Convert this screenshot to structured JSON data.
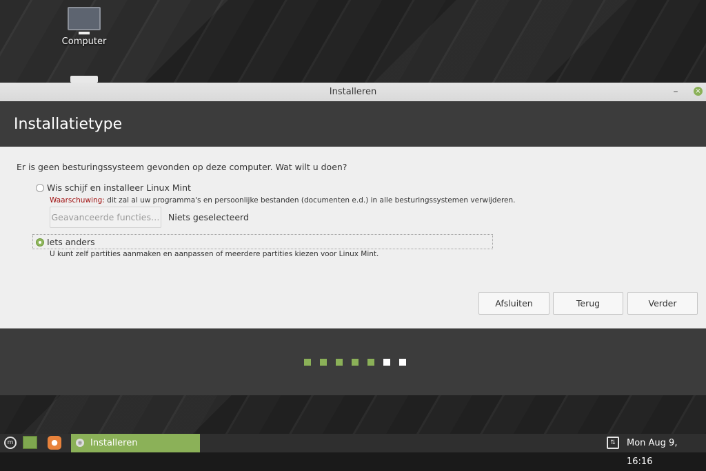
{
  "desktop": {
    "icons": [
      {
        "label": "Computer",
        "icon": "computer-icon"
      }
    ]
  },
  "window": {
    "title": "Installeren",
    "minimize_glyph": "–",
    "close_glyph": "×"
  },
  "header": {
    "title": "Installatietype"
  },
  "content": {
    "question": "Er is geen besturingssysteem gevonden op deze computer. Wat wilt u doen?",
    "option_erase": {
      "label": "Wis schijf en installeer Linux Mint",
      "selected": false,
      "warning_label": "Waarschuwing:",
      "warning_text": " dit zal al uw programma's en persoonlijke bestanden (documenten e.d.) in alle besturingssystemen verwijderen.",
      "advanced_button": "Geavanceerde functies…",
      "advanced_status": "Niets geselecteerd"
    },
    "option_other": {
      "label": "Iets anders",
      "selected": true,
      "description": "U kunt zelf partities aanmaken en aanpassen of meerdere partities kiezen voor Linux Mint."
    }
  },
  "buttons": {
    "quit": "Afsluiten",
    "back": "Terug",
    "next": "Verder"
  },
  "progress": {
    "total_steps": 7,
    "completed_steps": 5,
    "colors": {
      "done": "#8bb158",
      "todo": "#ffffff"
    }
  },
  "taskbar": {
    "launchers": [
      "mint-menu-icon",
      "files-icon",
      "firefox-icon"
    ],
    "task": {
      "label": "Installeren",
      "icon": "installer-disc-icon"
    },
    "clock": "Mon Aug  9, 16:16",
    "accent": "#8bb158"
  }
}
